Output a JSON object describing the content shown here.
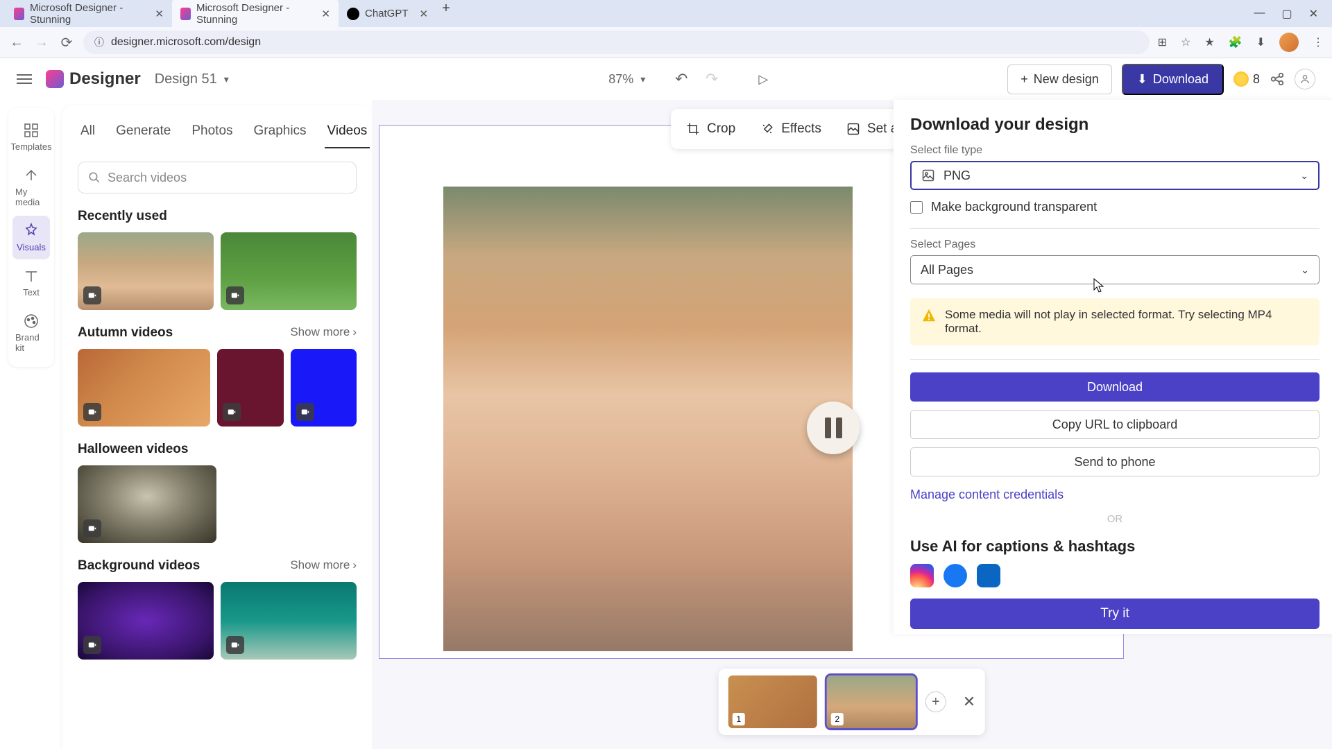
{
  "browser": {
    "tabs": [
      {
        "title": "Microsoft Designer - Stunning"
      },
      {
        "title": "Microsoft Designer - Stunning"
      },
      {
        "title": "ChatGPT"
      }
    ],
    "url": "designer.microsoft.com/design"
  },
  "header": {
    "logo_text": "Designer",
    "design_name": "Design 51",
    "zoom": "87%",
    "new_design": "New design",
    "download": "Download",
    "coins": "8"
  },
  "rail": {
    "templates": "Templates",
    "my_media": "My media",
    "visuals": "Visuals",
    "text": "Text",
    "brand_kit": "Brand kit"
  },
  "panel": {
    "tabs": {
      "all": "All",
      "generate": "Generate",
      "photos": "Photos",
      "graphics": "Graphics",
      "videos": "Videos"
    },
    "search_placeholder": "Search videos",
    "section_recent": "Recently used",
    "section_autumn": "Autumn videos",
    "section_halloween": "Halloween videos",
    "section_background": "Background videos",
    "show_more": "Show more"
  },
  "context_bar": {
    "crop": "Crop",
    "effects": "Effects",
    "set_bg": "Set as ba"
  },
  "download_panel": {
    "title": "Download your design",
    "select_file_type": "Select file type",
    "file_type": "PNG",
    "transparent_bg": "Make background transparent",
    "select_pages": "Select Pages",
    "pages_value": "All Pages",
    "warning": "Some media will not play in selected format. Try selecting MP4 format.",
    "download_btn": "Download",
    "copy_url": "Copy URL to clipboard",
    "send_phone": "Send to phone",
    "manage_creds": "Manage content credentials",
    "or": "OR",
    "ai_caption_title": "Use AI for captions & hashtags",
    "try_it": "Try it"
  },
  "pages": {
    "p1": "1",
    "p2": "2"
  }
}
